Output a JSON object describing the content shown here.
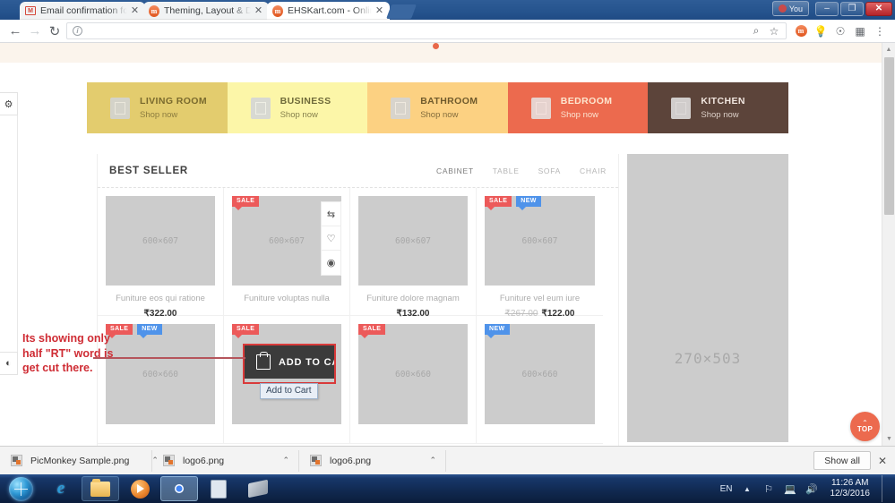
{
  "browser": {
    "tabs": [
      {
        "title": "Email confirmation for Je",
        "favicon": "gmail-icon",
        "active": false
      },
      {
        "title": "Theming, Layout & Desi",
        "favicon": "magento-icon",
        "active": false
      },
      {
        "title": "EHSKart.com - Online In",
        "favicon": "magento-icon",
        "active": true
      }
    ],
    "window_controls": {
      "you_label": "You",
      "minimize": "–",
      "maximize": "❐",
      "close": "✕"
    },
    "toolbar": {
      "back": "←",
      "forward": "→",
      "reload": "↻",
      "omnibox_value": "",
      "omnibox_placeholder": "",
      "info_glyph": "i",
      "search_glyph": "⌕",
      "star_glyph": "☆",
      "extensions": [
        "magento-ext-icon",
        "bulb-ext-icon",
        "at-ext-icon",
        "my-ext-icon"
      ],
      "menu_glyph": "⋮"
    }
  },
  "page": {
    "left_toolbar": {
      "settings_glyph": "⚙",
      "contrast_glyph": "◐"
    },
    "categories": [
      {
        "label": "LIVING ROOM",
        "sub": "Shop now",
        "bg": "#e3cc6e",
        "fg": "#7a6a2e",
        "subfg": "#8c7c3f"
      },
      {
        "label": "BUSINESS",
        "sub": "Shop now",
        "bg": "#fcf6a8",
        "fg": "#6f6a3a",
        "subfg": "#86804c"
      },
      {
        "label": "BATHROOM",
        "sub": "Shop now",
        "bg": "#fcd182",
        "fg": "#6f5a2c",
        "subfg": "#836c3c"
      },
      {
        "label": "BEDROOM",
        "sub": "Shop now",
        "bg": "#ec6a4e",
        "fg": "#fde6cf",
        "subfg": "#fbe3d0"
      },
      {
        "label": "KITCHEN",
        "sub": "Shop now",
        "bg": "#5c443a",
        "fg": "#f0e5de",
        "subfg": "#ddd0c8"
      }
    ],
    "best_seller": {
      "title": "BEST SELLER",
      "tabs": [
        {
          "label": "CABINET",
          "active": true
        },
        {
          "label": "TABLE",
          "active": false
        },
        {
          "label": "SOFA",
          "active": false
        },
        {
          "label": "CHAIR",
          "active": false
        }
      ],
      "products_row1": [
        {
          "ph": "600×607",
          "name": "Funiture eos qui ratione",
          "price": "₹322.00",
          "old_price": "",
          "badges": []
        },
        {
          "ph": "600×607",
          "name": "Funiture voluptas nulla",
          "price": "",
          "old_price": "",
          "badges": [
            "SALE"
          ],
          "hovered": true
        },
        {
          "ph": "600×607",
          "name": "Funiture dolore magnam",
          "price": "₹132.00",
          "old_price": "",
          "badges": []
        },
        {
          "ph": "600×607",
          "name": "Funiture vel eum iure",
          "price": "₹122.00",
          "old_price": "₹267.00",
          "badges": [
            "SALE",
            "NEW"
          ]
        }
      ],
      "products_row2": [
        {
          "ph": "600×660",
          "badges": [
            "SALE",
            "NEW"
          ]
        },
        {
          "ph": "600×660",
          "badges": [
            "SALE"
          ]
        },
        {
          "ph": "600×660",
          "badges": [
            "SALE"
          ]
        },
        {
          "ph": "600×660",
          "badges": [
            "NEW"
          ]
        }
      ],
      "hover_actions": [
        {
          "name": "compare-icon",
          "glyph": "⇆"
        },
        {
          "name": "wishlist-icon",
          "glyph": "♡"
        },
        {
          "name": "quickview-icon",
          "glyph": "◉"
        }
      ],
      "add_to_cart": {
        "label": "ADD TO CAR",
        "full_label": "ADD TO CART",
        "icon": "bag-icon"
      },
      "tooltip": "Add to Cart"
    },
    "right_ad": {
      "placeholder": "270×503"
    },
    "scroll_top_button": {
      "label": "TOP",
      "carat": "⌃"
    },
    "annotation": "Its showing only half \"RT\" word is get cut there.",
    "annotation_color": "#cf2c34"
  },
  "downloads_bar": {
    "items": [
      {
        "name": "PicMonkey Sample.png",
        "caret": "⌃"
      },
      {
        "name": "logo6.png",
        "caret": "⌃"
      },
      {
        "name": "logo6.png",
        "caret": "⌃"
      }
    ],
    "show_all": "Show all",
    "close": "✕"
  },
  "taskbar": {
    "start": "windows-orb",
    "buttons": [
      "internet-explorer-icon",
      "file-explorer-icon",
      "media-player-icon",
      "chrome-icon",
      "calculator-icon",
      "scanner-icon"
    ],
    "tray": {
      "language": "EN",
      "expand": "▲",
      "icons": [
        "flag-icon",
        "network-icon",
        "volume-icon"
      ],
      "time": "11:26 AM",
      "date": "12/3/2016"
    }
  }
}
